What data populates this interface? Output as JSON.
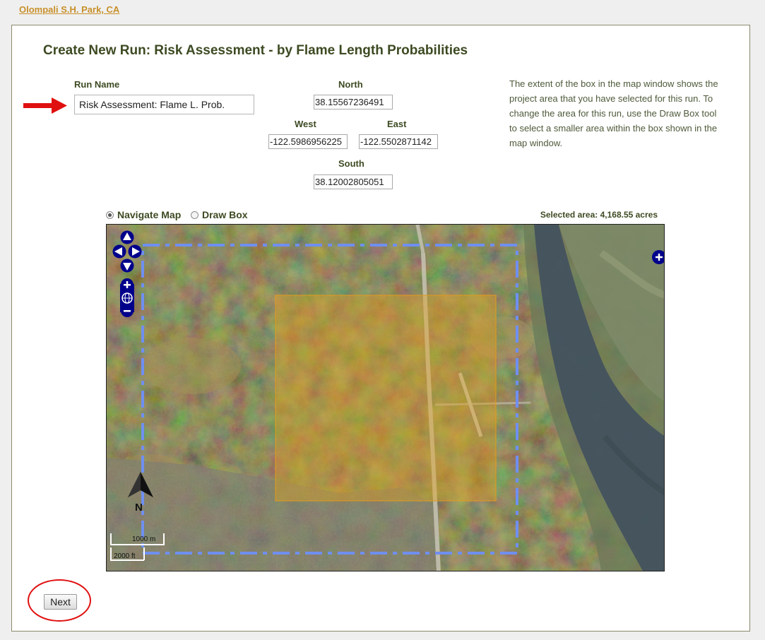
{
  "breadcrumb": {
    "park": "Olompali S.H. Park, CA"
  },
  "page": {
    "title": "Create New Run: Risk Assessment - by Flame Length Probabilities"
  },
  "run_name": {
    "label": "Run Name",
    "value": "Risk Assessment: Flame L. Prob."
  },
  "extent": {
    "north_label": "North",
    "north_value": "38.15567236491",
    "west_label": "West",
    "west_value": "-122.5986956225",
    "east_label": "East",
    "east_value": "-122.5502871142",
    "south_label": "South",
    "south_value": "38.12002805051"
  },
  "help_text": "The extent of the box in the map window shows the project area that you have selected for this run. To change the area for this run, use the Draw Box tool to select a smaller area within the box shown in the map window.",
  "map_mode": {
    "navigate_label": "Navigate Map",
    "draw_label": "Draw Box",
    "selected": "navigate"
  },
  "selected_area": "Selected area: 4,168.55 acres",
  "map": {
    "north_arrow": "N",
    "scale_metric": "1000 m",
    "scale_imperial": "2000 ft",
    "icons": [
      "pan-up-icon",
      "pan-left-icon",
      "pan-right-icon",
      "pan-down-icon",
      "zoom-in-icon",
      "zoom-world-icon",
      "zoom-out-icon",
      "layer-switcher-icon"
    ]
  },
  "actions": {
    "next_label": "Next"
  },
  "colors": {
    "heading": "#3d4a22",
    "link": "#c8902a",
    "extent_box": "#6f8ff0",
    "selection": "#e0a020",
    "annotation": "#e01010",
    "map_control": "#00008b"
  }
}
